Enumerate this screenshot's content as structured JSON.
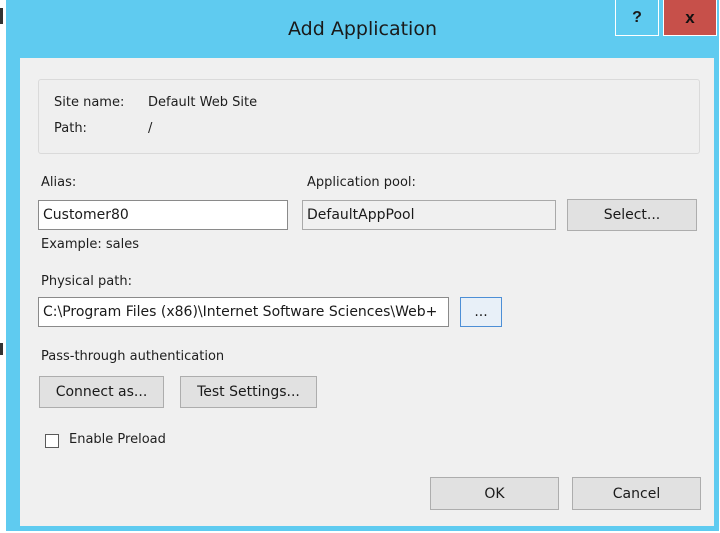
{
  "window": {
    "title": "Add Application",
    "help_label": "?",
    "close_label": "x"
  },
  "site_info": {
    "site_name_label": "Site name:",
    "site_name_value": "Default Web Site",
    "path_label": "Path:",
    "path_value": "/"
  },
  "alias": {
    "label": "Alias:",
    "value": "Customer80",
    "example": "Example: sales"
  },
  "app_pool": {
    "label": "Application pool:",
    "value": "DefaultAppPool",
    "select_button": "Select..."
  },
  "physical_path": {
    "label": "Physical path:",
    "value": "C:\\Program Files (x86)\\Internet Software Sciences\\Web+",
    "browse_button": "..."
  },
  "auth": {
    "label": "Pass-through authentication",
    "connect_button": "Connect as...",
    "test_button": "Test Settings..."
  },
  "preload": {
    "label": "Enable Preload",
    "checked": false
  },
  "footer": {
    "ok_button": "OK",
    "cancel_button": "Cancel"
  },
  "colors": {
    "title_bar": "#5fcbf0",
    "close_button": "#c7504a",
    "dialog_body": "#f0f0f0"
  }
}
